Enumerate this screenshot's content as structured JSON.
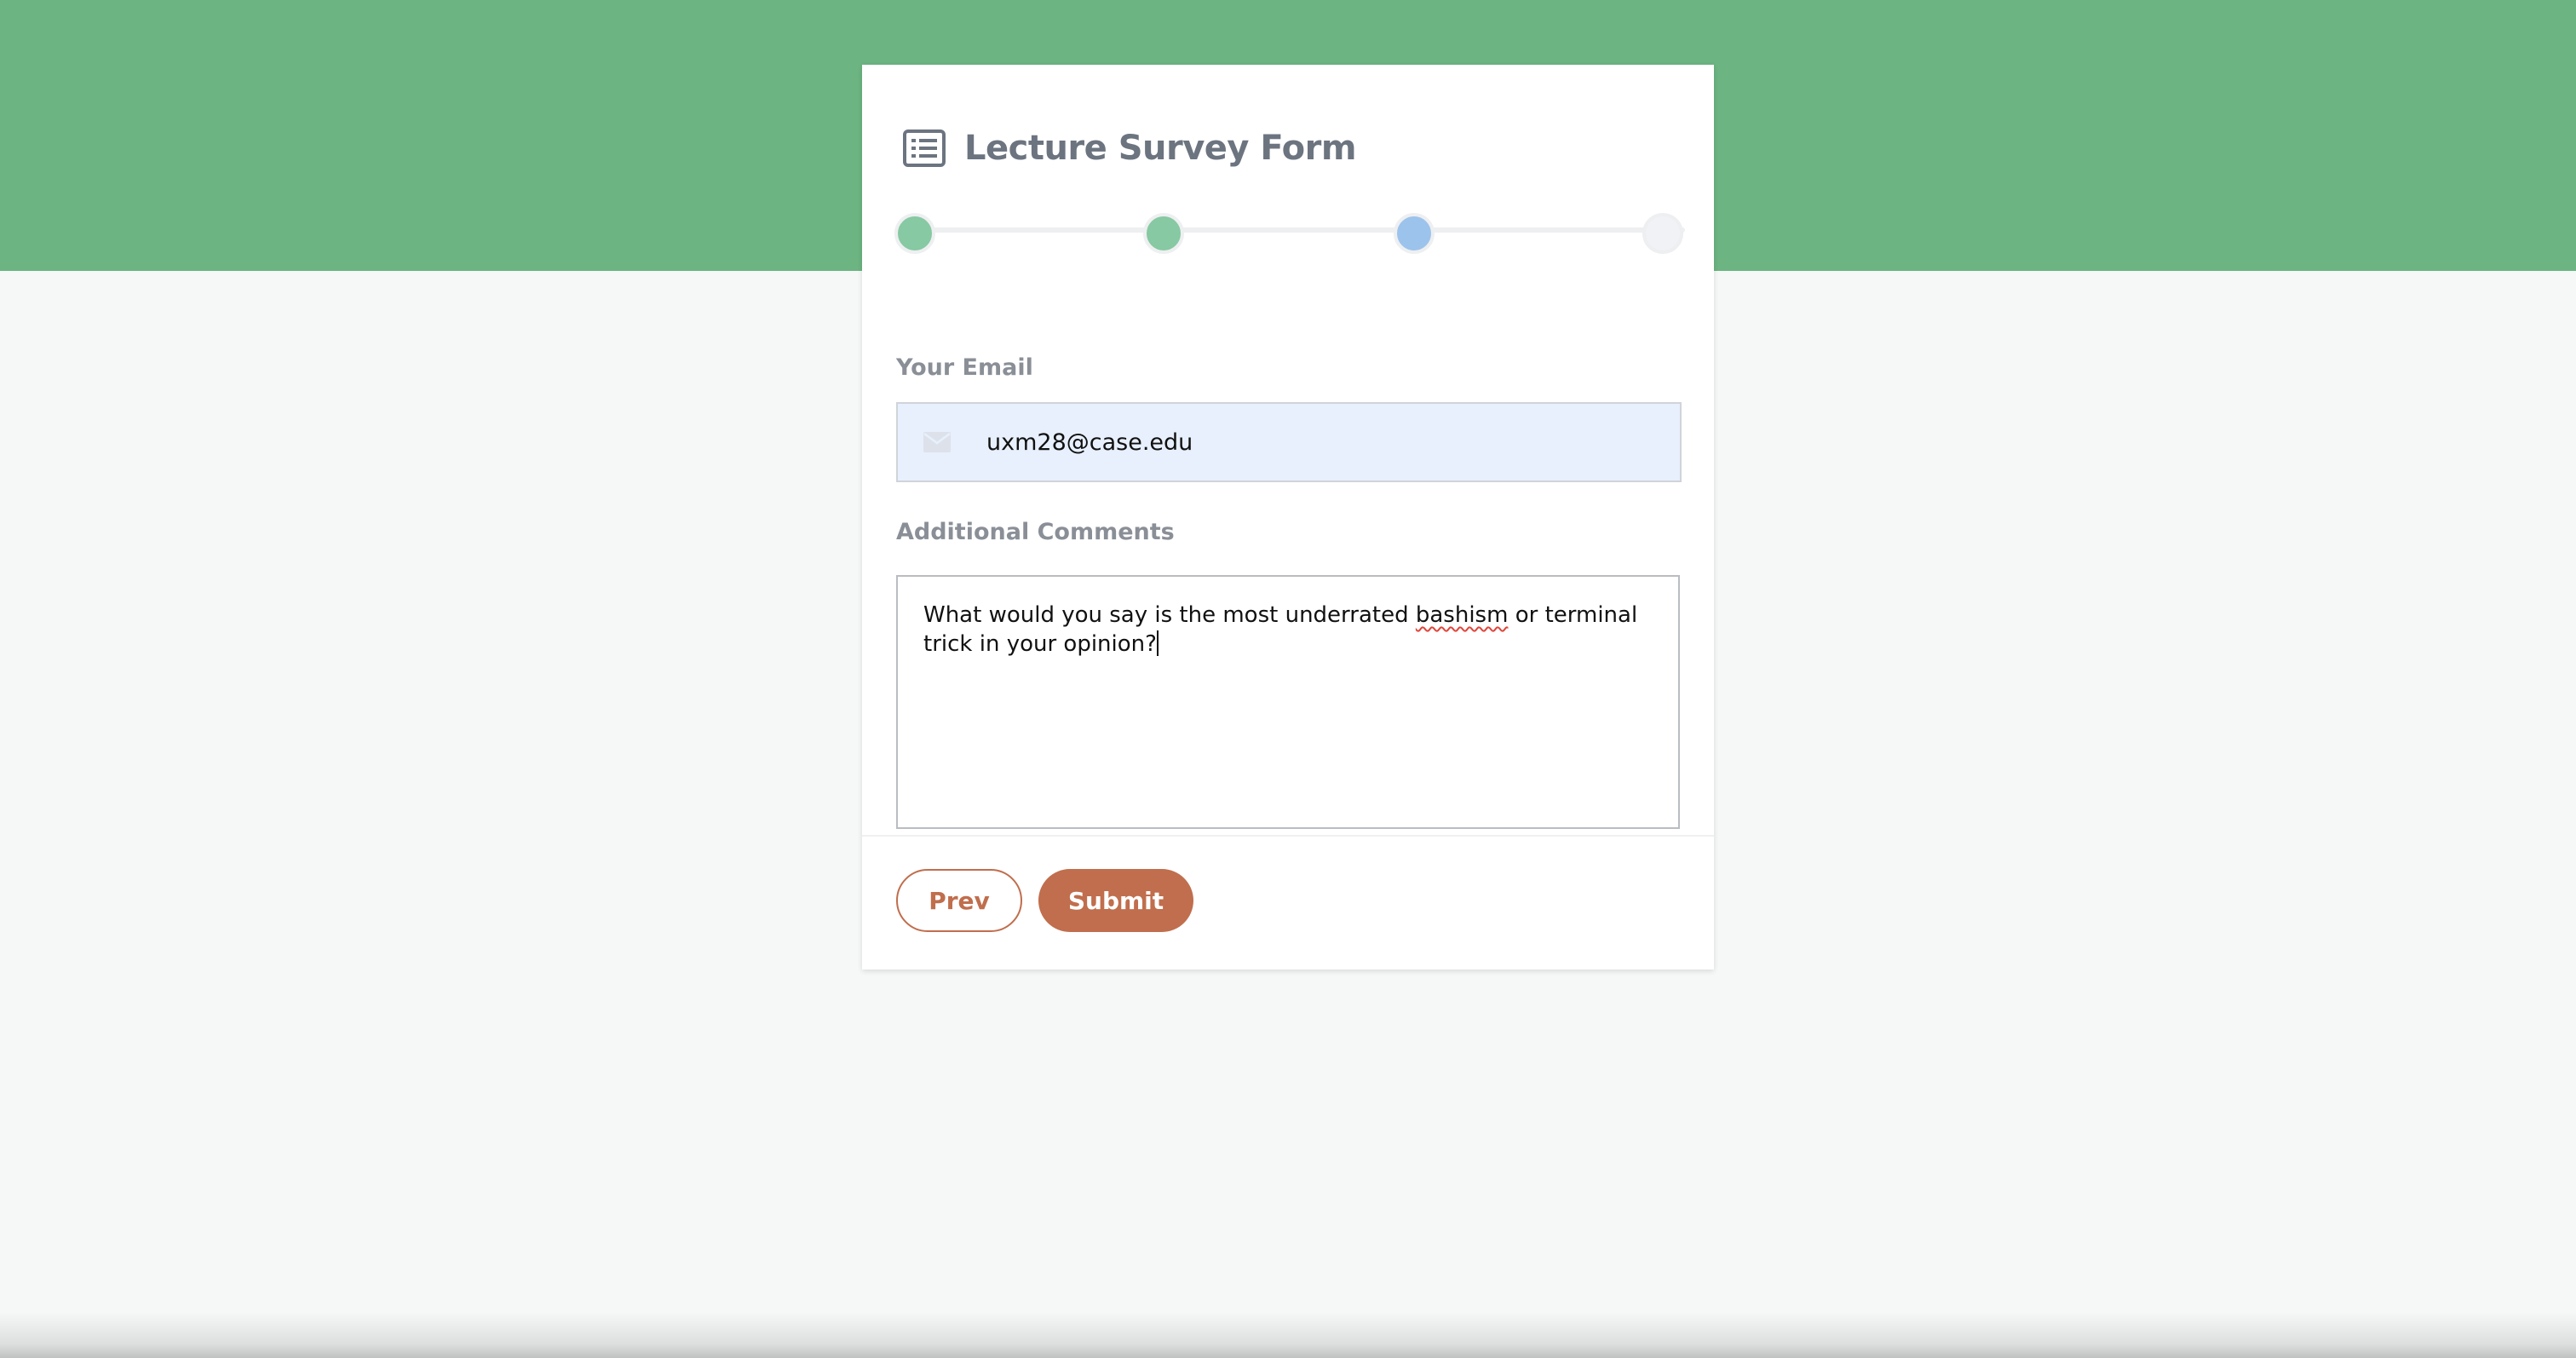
{
  "form": {
    "title": "Lecture Survey Form",
    "icon": "list-form-icon"
  },
  "progress": {
    "steps": [
      {
        "state": "complete",
        "color": "#86c9a2"
      },
      {
        "state": "complete",
        "color": "#86c9a2"
      },
      {
        "state": "active",
        "color": "#9cc3ec"
      },
      {
        "state": "pending",
        "color": "#f1f2f5"
      }
    ]
  },
  "email": {
    "label": "Your Email",
    "icon": "envelope-icon",
    "value": "uxm28@case.edu"
  },
  "comments": {
    "label": "Additional Comments",
    "text_before": "What would you say is the most underrated ",
    "misspelled_word": "bashism",
    "text_after": " or terminal trick in your opinion?"
  },
  "buttons": {
    "prev_label": "Prev",
    "submit_label": "Submit"
  },
  "colors": {
    "header_band": "#6cb482",
    "accent": "#c06e4d",
    "background": "#f6f8f7"
  }
}
